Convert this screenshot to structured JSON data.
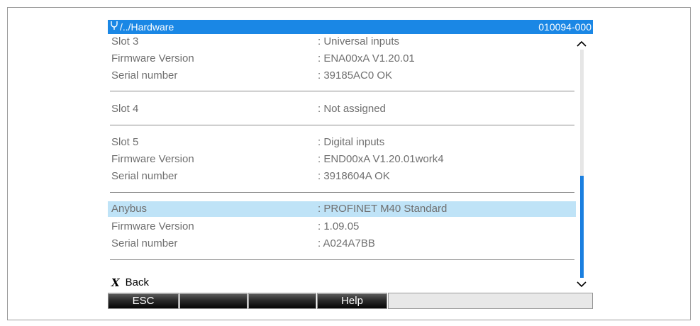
{
  "titlebar": {
    "path": "/../Hardware",
    "code": "010094-000",
    "icon": "stethoscope-icon"
  },
  "rows": [
    {
      "label": "Slot 3",
      "value": ": Universal inputs"
    },
    {
      "label": "Firmware Version",
      "value": ": ENA00xA V1.20.01"
    },
    {
      "label": "Serial number",
      "value": ": 39185AC0 OK"
    },
    {
      "label": "Slot 4",
      "value": ": Not assigned"
    },
    {
      "label": "Slot 5",
      "value": ": Digital inputs"
    },
    {
      "label": "Firmware Version",
      "value": ": END00xA V1.20.01work4"
    },
    {
      "label": "Serial number",
      "value": ": 3918604A OK"
    },
    {
      "label": "Anybus",
      "value": ": PROFINET M40 Standard"
    },
    {
      "label": "Firmware Version",
      "value": ": 1.09.05"
    },
    {
      "label": "Serial number",
      "value": ": A024A7BB"
    }
  ],
  "back": {
    "label": "Back",
    "icon": "x-icon"
  },
  "softkeys": [
    "ESC",
    "",
    "",
    "Help",
    ""
  ],
  "colors": {
    "titlebar": "#1a87e5",
    "selection": "#bfe3f7",
    "scroll_thumb": "#1a7fe0"
  }
}
